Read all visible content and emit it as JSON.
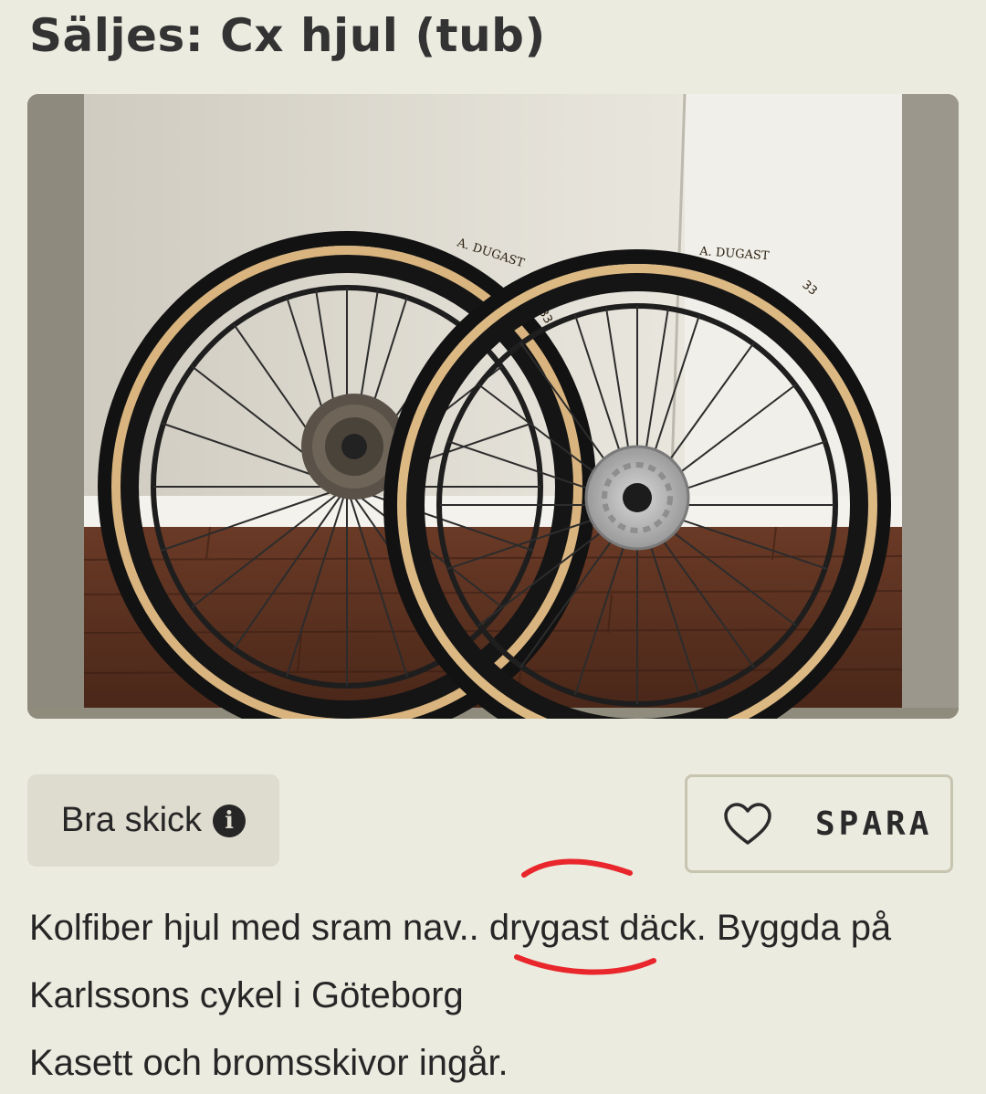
{
  "listing": {
    "title": "Säljes: Cx hjul (tub)",
    "condition": "Bra skick",
    "save_label": "SPARA",
    "description_lines": [
      "Kolfiber hjul med sram nav.. drygast däck. Byggda på",
      "Karlssons cykel i Göteborg",
      "Kasett och bromsskivor ingår."
    ]
  },
  "photo": {
    "tire_brand": "A. DUGAST",
    "tire_size": "33"
  },
  "icons": {
    "info": "info-icon",
    "save": "heart-icon"
  },
  "colors": {
    "background": "#ecebe0",
    "chip": "#dedbcf",
    "annotation": "#e8262b"
  }
}
